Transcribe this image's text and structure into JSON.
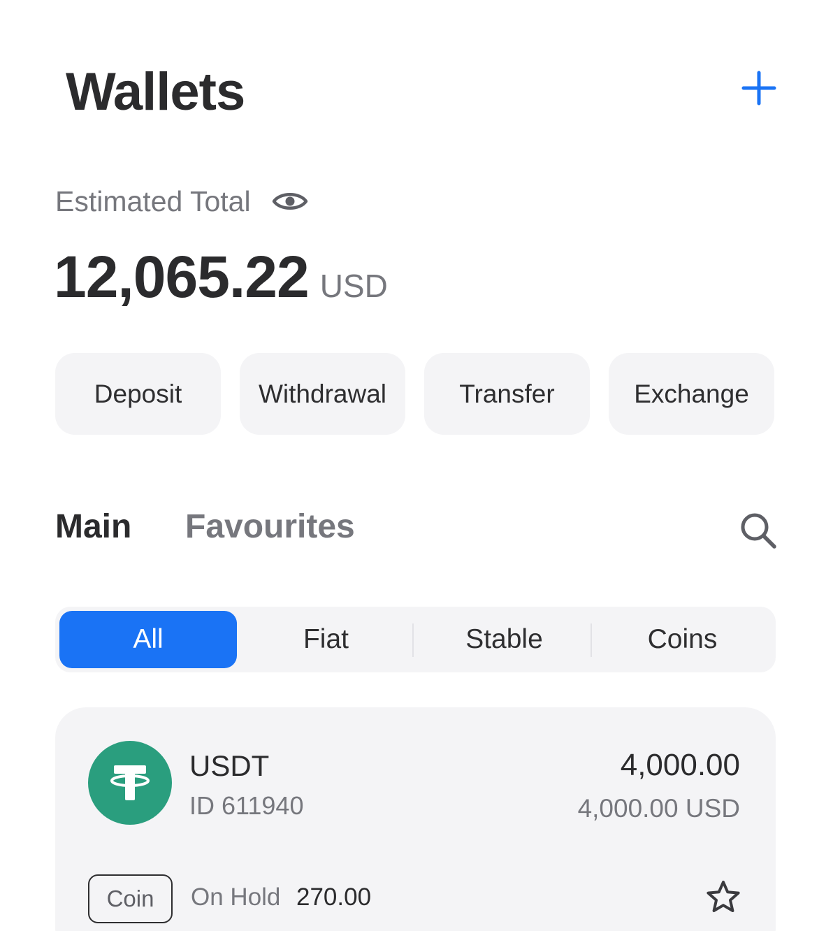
{
  "header": {
    "title": "Wallets",
    "add_icon": "plus-icon"
  },
  "summary": {
    "label": "Estimated Total",
    "visibility_icon": "eye-icon",
    "amount": "12,065.22",
    "currency": "USD"
  },
  "actions": [
    {
      "label": "Deposit"
    },
    {
      "label": "Withdrawal"
    },
    {
      "label": "Transfer"
    },
    {
      "label": "Exchange"
    }
  ],
  "tabs": {
    "main": "Main",
    "favourites": "Favourites",
    "active": "Main",
    "search_icon": "search-icon"
  },
  "filters": {
    "items": [
      "All",
      "Fiat",
      "Stable",
      "Coins"
    ],
    "selected": "All"
  },
  "wallets": [
    {
      "symbol": "USDT",
      "id": "ID 611940",
      "balance": "4,000.00",
      "balance_usd": "4,000.00 USD",
      "type": "Coin",
      "on_hold_label": "On Hold",
      "on_hold_value": "270.00",
      "logo_icon": "tether-icon",
      "favourite_icon": "star-icon"
    }
  ],
  "colors": {
    "accent": "#1a73f5",
    "tether": "#2a9e7e",
    "text_primary": "#2b2b2d",
    "text_secondary": "#76777d",
    "surface": "#f4f4f6"
  }
}
